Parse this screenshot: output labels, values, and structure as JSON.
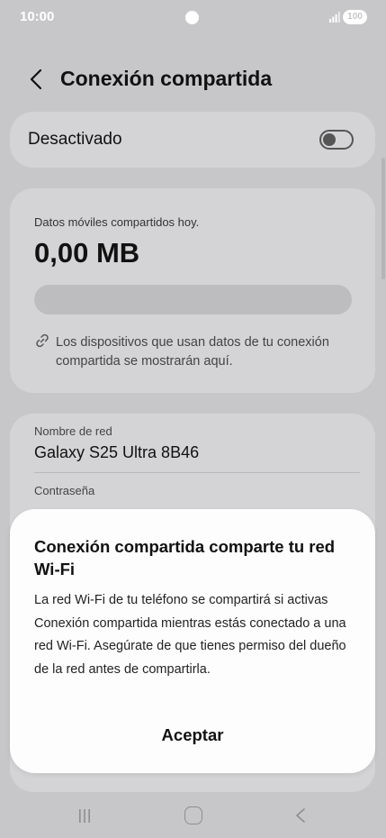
{
  "status_bar": {
    "time": "10:00",
    "battery": "100"
  },
  "header": {
    "title": "Conexión compartida"
  },
  "toggle": {
    "label": "Desactivado",
    "state": "off"
  },
  "usage": {
    "label": "Datos móviles compartidos hoy.",
    "value": "0,00 MB",
    "progress_percent": 0,
    "devices_note": "Los dispositivos que usan datos de tu conexión compartida se mostrarán aquí."
  },
  "network": {
    "name_label": "Nombre de red",
    "name_value": "Galaxy S25 Ultra 8B46",
    "password_label": "Contraseña"
  },
  "dialog": {
    "title": "Conexión compartida comparte tu red Wi-Fi",
    "body": "La red Wi-Fi de tu teléfono se compartirá si activas Conexión compartida mientras estás conectado a una red Wi-Fi. Asegúrate de que tienes permiso del dueño de la red antes de compartirla.",
    "accept_label": "Aceptar"
  },
  "icons": {
    "back": "chevron-left-icon",
    "link": "link-icon",
    "nav_recents": "recents-icon",
    "nav_home": "home-icon",
    "nav_back": "back-icon"
  }
}
